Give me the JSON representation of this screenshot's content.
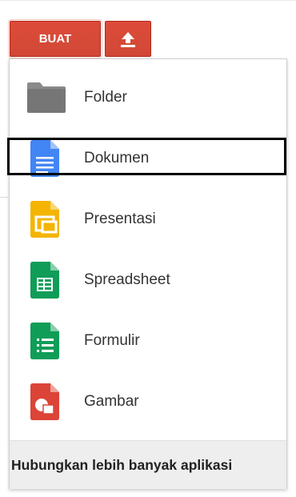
{
  "toolbar": {
    "create_label": "BUAT",
    "upload_icon": "upload-icon"
  },
  "menu": {
    "items": [
      {
        "label": "Folder",
        "icon": "folder-icon"
      },
      {
        "label": "Dokumen",
        "icon": "document-icon"
      },
      {
        "label": "Presentasi",
        "icon": "presentation-icon"
      },
      {
        "label": "Spreadsheet",
        "icon": "spreadsheet-icon"
      },
      {
        "label": "Formulir",
        "icon": "form-icon"
      },
      {
        "label": "Gambar",
        "icon": "drawing-icon"
      }
    ],
    "footer_label": "Hubungkan lebih banyak aplikasi"
  },
  "colors": {
    "accent": "#d14836",
    "folder": "#8a8a8a",
    "document": "#4285f4",
    "presentation": "#f4b400",
    "spreadsheet": "#0f9d58",
    "form": "#0f9d58",
    "drawing": "#db4437"
  }
}
